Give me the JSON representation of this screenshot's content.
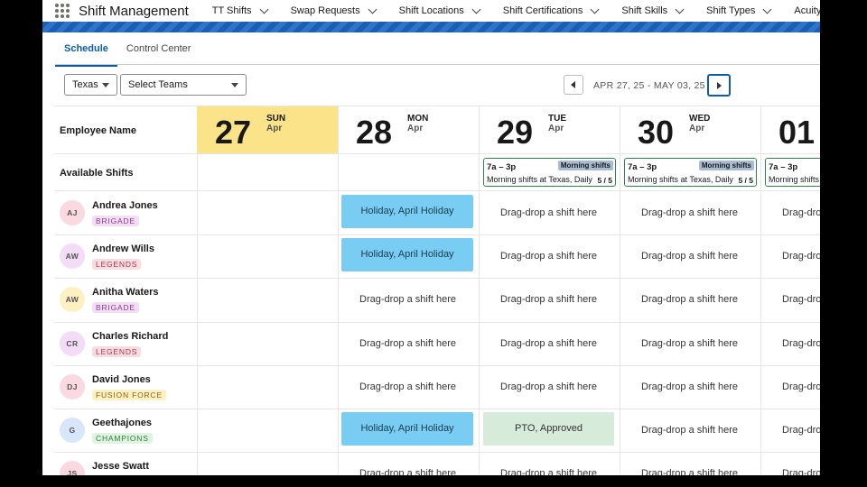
{
  "app": {
    "name": "Shift Management",
    "nav": [
      "TT Shifts",
      "Swap Requests",
      "Shift Locations",
      "Shift Certifications",
      "Shift Skills",
      "Shift Types",
      "Acuity Levels"
    ]
  },
  "tabs": [
    "Schedule",
    "Control Center"
  ],
  "filters": {
    "state": "Texas",
    "team_placeholder": "Select Teams",
    "date_range": "APR 27, 25 - MAY 03, 25"
  },
  "grid": {
    "employee_header": "Employee Name",
    "available_shifts_label": "Available Shifts",
    "days": [
      {
        "num": "27",
        "dow": "SUN",
        "mon": "Apr",
        "today": true
      },
      {
        "num": "28",
        "dow": "MON",
        "mon": "Apr"
      },
      {
        "num": "29",
        "dow": "TUE",
        "mon": "Apr"
      },
      {
        "num": "30",
        "dow": "WED",
        "mon": "Apr"
      },
      {
        "num": "01",
        "dow": "",
        "mon": ""
      }
    ],
    "available_shifts": [
      {
        "time": "7a – 3p",
        "tag": "Morning shifts",
        "desc": "Morning shifts at Texas, Daily",
        "count": "5 / 5"
      },
      {
        "time": "7a – 3p",
        "tag": "Morning shifts",
        "desc": "Morning shifts at Texas, Daily",
        "count": "5 / 5"
      },
      {
        "time": "7a – 3p",
        "tag": "",
        "desc": "Morning shifts",
        "count": ""
      }
    ],
    "drop_hint": "Drag-drop a shift here",
    "drop_hint_cut": "Drag-dro",
    "holiday_label": "Holiday, April Holiday",
    "pto_label": "PTO, Approved"
  },
  "employees": [
    {
      "initials": "AJ",
      "name": "Andrea Jones",
      "team": "BRIGADE",
      "avatar_color": "#fbd9e0",
      "badge_bg": "#f3dcf5",
      "badge_fg": "#8a3a90"
    },
    {
      "initials": "AW",
      "name": "Andrew Wills",
      "team": "LEGENDS",
      "avatar_color": "#f3dcf5",
      "badge_bg": "#f9dce1",
      "badge_fg": "#a33a4a"
    },
    {
      "initials": "AW",
      "name": "Anitha Waters",
      "team": "BRIGADE",
      "avatar_color": "#fdf0c2",
      "badge_bg": "#f3dcf5",
      "badge_fg": "#8a3a90"
    },
    {
      "initials": "CR",
      "name": "Charles Richard",
      "team": "LEGENDS",
      "avatar_color": "#f3dcf5",
      "badge_bg": "#f9dce1",
      "badge_fg": "#a33a4a"
    },
    {
      "initials": "DJ",
      "name": "David Jones",
      "team": "FUSION FORCE",
      "avatar_color": "#fbd9e0",
      "badge_bg": "#fdf0c2",
      "badge_fg": "#8a6410"
    },
    {
      "initials": "G",
      "name": "Geethajones",
      "team": "CHAMPIONS",
      "avatar_color": "#d8e6fb",
      "badge_bg": "#dff3e1",
      "badge_fg": "#2e7d3a"
    },
    {
      "initials": "JS",
      "name": "Jesse Swatt",
      "team": "",
      "avatar_color": "#fbd9e0",
      "badge_bg": "#ffffff",
      "badge_fg": "#333333"
    }
  ],
  "cells": [
    [
      "empty",
      "holiday",
      "drop",
      "drop",
      "cut"
    ],
    [
      "empty",
      "holiday",
      "drop",
      "drop",
      "cut"
    ],
    [
      "empty",
      "drop",
      "drop",
      "drop",
      "cut"
    ],
    [
      "empty",
      "drop",
      "drop",
      "drop",
      "cut"
    ],
    [
      "empty",
      "drop",
      "drop",
      "drop",
      "cut"
    ],
    [
      "empty",
      "holiday",
      "pto",
      "drop",
      "cut"
    ],
    [
      "empty",
      "drop",
      "drop",
      "drop",
      "cut"
    ]
  ]
}
